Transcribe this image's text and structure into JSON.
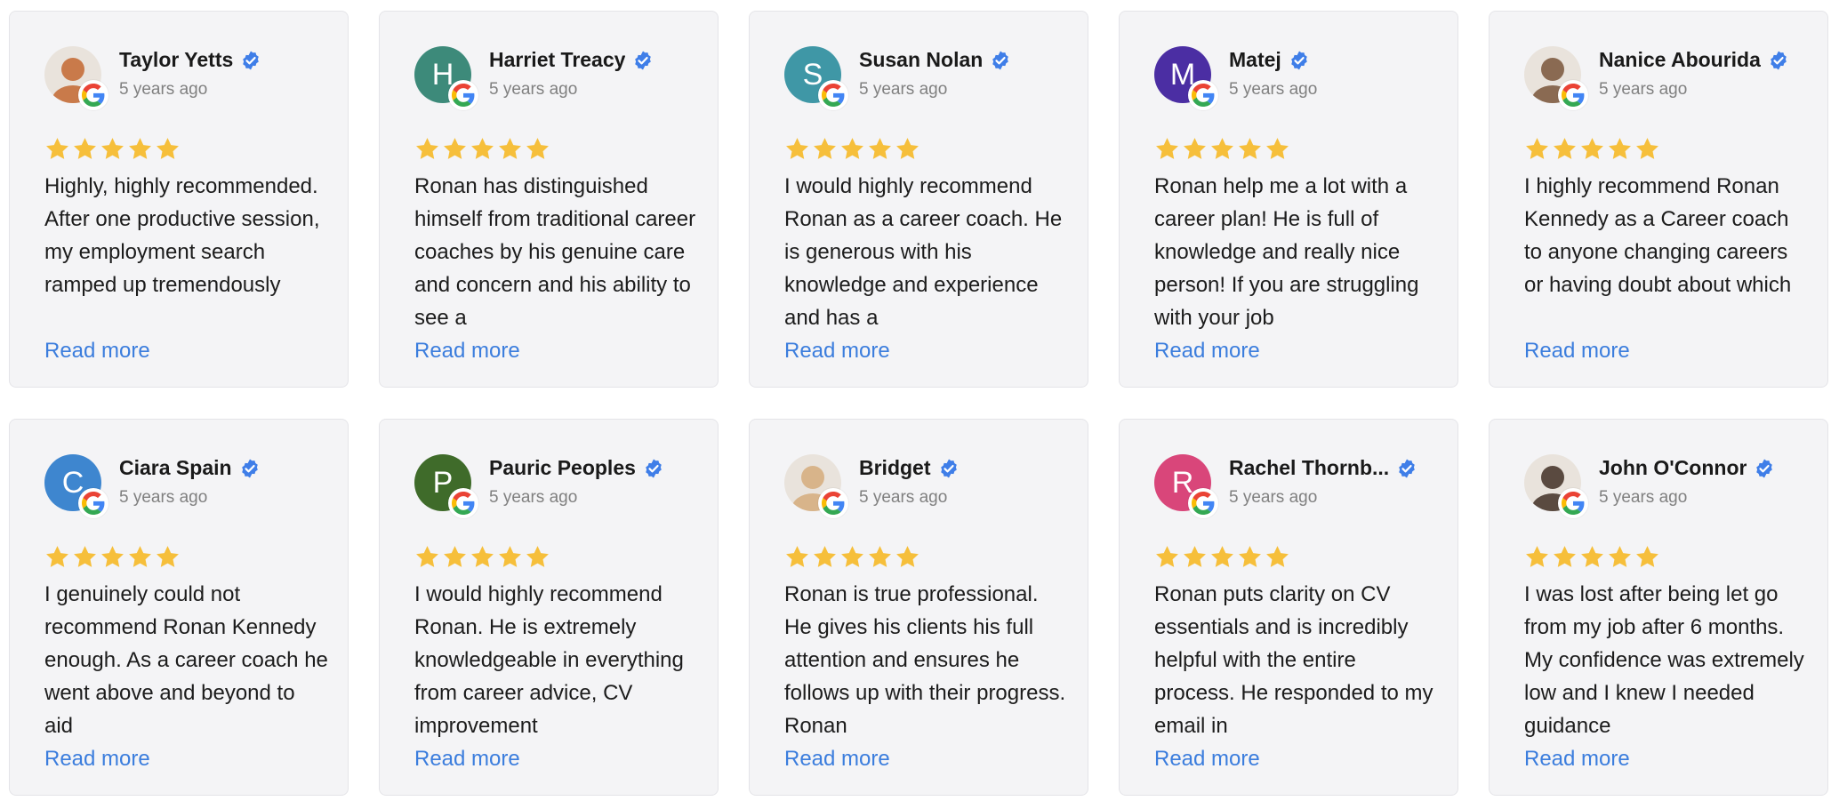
{
  "reviews": [
    {
      "name": "Taylor Yetts",
      "date": "5 years ago",
      "avatar_initial": "",
      "avatar_type": "photo",
      "avatar_color": "#c97a4a",
      "rating": 5,
      "text": "Highly, highly recommended. After one productive session, my employment search ramped up tremendously",
      "read_more": "Read more"
    },
    {
      "name": "Harriet Treacy",
      "date": "5 years ago",
      "avatar_initial": "H",
      "avatar_type": "initial",
      "avatar_color": "#3d8a7a",
      "rating": 5,
      "text": "Ronan has distinguished himself from traditional career coaches by his genuine care and concern and his ability to see a",
      "read_more": "Read more"
    },
    {
      "name": "Susan Nolan",
      "date": "5 years ago",
      "avatar_initial": "S",
      "avatar_type": "initial",
      "avatar_color": "#3f97a6",
      "rating": 5,
      "text": "I would highly recommend Ronan as a career coach. He is generous with his knowledge and experience and has a",
      "read_more": "Read more"
    },
    {
      "name": "Matej",
      "date": "5 years ago",
      "avatar_initial": "M",
      "avatar_type": "initial",
      "avatar_color": "#4b2ea3",
      "rating": 5,
      "text": "Ronan help me a lot with a career plan! He is full of knowledge and really nice person! If you are struggling with your job",
      "read_more": "Read more"
    },
    {
      "name": "Nanice Abourida",
      "date": "5 years ago",
      "avatar_initial": "",
      "avatar_type": "photo",
      "avatar_color": "#8a6a52",
      "rating": 5,
      "text": "I highly recommend Ronan Kennedy as a Career coach to anyone changing careers or having doubt about which",
      "read_more": "Read more"
    },
    {
      "name": "Ciara Spain",
      "date": "5 years ago",
      "avatar_initial": "C",
      "avatar_type": "initial",
      "avatar_color": "#3e86cf",
      "rating": 5,
      "text": "I genuinely could not recommend Ronan Kennedy enough. As a career coach he went above and beyond to aid",
      "read_more": "Read more"
    },
    {
      "name": "Pauric Peoples",
      "date": "5 years ago",
      "avatar_initial": "P",
      "avatar_type": "initial",
      "avatar_color": "#3f6b2a",
      "rating": 5,
      "text": "I would highly recommend Ronan. He is extremely knowledgeable in everything from career advice, CV improvement",
      "read_more": "Read more"
    },
    {
      "name": "Bridget",
      "date": "5 years ago",
      "avatar_initial": "",
      "avatar_type": "photo",
      "avatar_color": "#d8b48a",
      "rating": 5,
      "text": "Ronan is true professional. He gives his clients his full attention and ensures he follows up with their progress. Ronan",
      "read_more": "Read more"
    },
    {
      "name": "Rachel Thornb...",
      "date": "5 years ago",
      "avatar_initial": "R",
      "avatar_type": "initial",
      "avatar_color": "#d9467a",
      "rating": 5,
      "text": "Ronan puts clarity on CV essentials and is incredibly helpful with the entire process. He responded to my email in",
      "read_more": "Read more"
    },
    {
      "name": "John O'Connor",
      "date": "5 years ago",
      "avatar_initial": "",
      "avatar_type": "photo",
      "avatar_color": "#5a4a40",
      "rating": 5,
      "text": "I was lost after being let go from my job after 6 months. My confidence was extremely low and I knew I needed guidance",
      "read_more": "Read more"
    }
  ],
  "colors": {
    "star": "#f6bf3b",
    "verified": "#3f7ee8",
    "link": "#3b7ddd",
    "card_bg": "#f4f4f6"
  }
}
